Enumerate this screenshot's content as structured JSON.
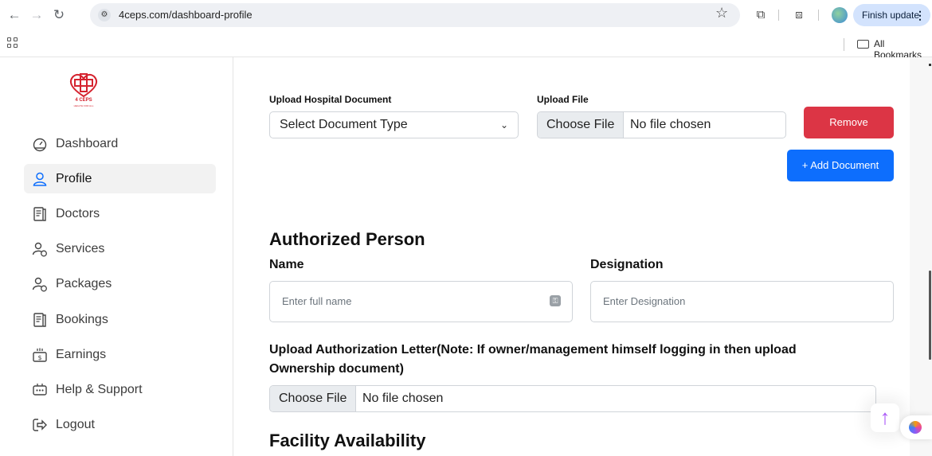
{
  "browser": {
    "url": "4ceps.com/dashboard-profile",
    "finish_update": "Finish update",
    "bookmarks_label": "All Bookmarks"
  },
  "sidebar": {
    "logo_text": "4 CEPS",
    "logo_sub": "HEALTH FOR ALL",
    "items": [
      {
        "label": "Dashboard",
        "icon": "dashboard-icon"
      },
      {
        "label": "Profile",
        "icon": "user-icon",
        "active": true
      },
      {
        "label": "Doctors",
        "icon": "document-icon"
      },
      {
        "label": "Services",
        "icon": "user-shield-icon"
      },
      {
        "label": "Packages",
        "icon": "user-shield-icon"
      },
      {
        "label": "Bookings",
        "icon": "document-icon"
      },
      {
        "label": "Earnings",
        "icon": "cash-icon"
      },
      {
        "label": "Help & Support",
        "icon": "chat-icon"
      },
      {
        "label": "Logout",
        "icon": "logout-icon"
      }
    ]
  },
  "hospital_doc": {
    "upload_label": "Upload Hospital Document",
    "select_value": "Select Document Type",
    "file_label": "Upload File",
    "choose_file": "Choose File",
    "no_file": "No file chosen",
    "remove": "Remove",
    "add_document": "+ Add Document"
  },
  "authorized": {
    "heading": "Authorized Person",
    "name_label": "Name",
    "name_placeholder": "Enter full name",
    "designation_label": "Designation",
    "designation_placeholder": "Enter Designation",
    "letter_label": "Upload Authorization Letter(Note: If owner/management himself logging in then upload Ownership document)",
    "choose_file": "Choose File",
    "no_file": "No file chosen"
  },
  "facility": {
    "heading": "Facility Availability"
  },
  "colors": {
    "primary": "#0d6efd",
    "danger": "#dc3545",
    "brand": "#d5232f"
  }
}
